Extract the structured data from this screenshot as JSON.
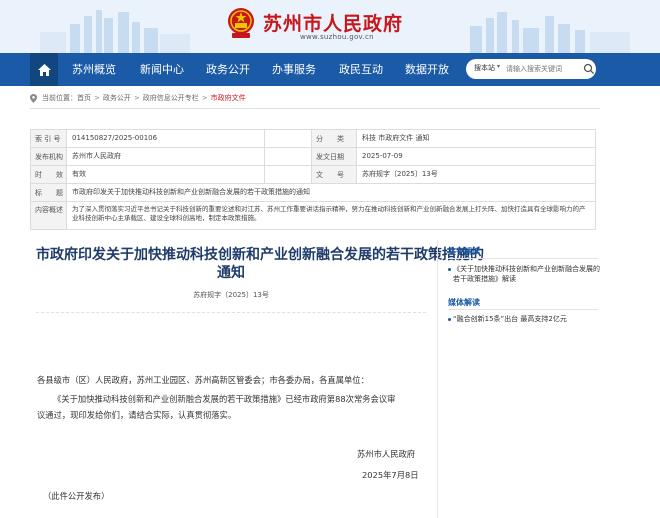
{
  "header": {
    "site_title": "苏州市人民政府",
    "site_url": "www.suzhou.gov.cn"
  },
  "nav": {
    "home_icon": "home-icon",
    "items": [
      "苏州概览",
      "新闻中心",
      "政务公开",
      "办事服务",
      "政民互动",
      "数据开放"
    ]
  },
  "search": {
    "scope_label": "搜本站",
    "placeholder": "请输入搜索关键词"
  },
  "breadcrumb": {
    "prefix": "当前位置：",
    "items": [
      "首页",
      "政务公开",
      "政府信息公开专栏",
      "市政府文件"
    ],
    "separator": ">"
  },
  "meta": {
    "index_label": "索 引 号",
    "index_value": "014150827/2025-00106",
    "category_label": "分　　类",
    "category_value": "科技 市政府文件 通知",
    "issuer_label": "发布机构",
    "issuer_value": "苏州市人民政府",
    "date_label": "发文日期",
    "date_value": "2025-07-09",
    "validity_label": "时　　效",
    "validity_value": "有效",
    "docno_label": "文　　号",
    "docno_value": "苏府规字〔2025〕13号",
    "title_label": "标　　题",
    "title_value": "市政府印发关于加快推动科技创新和产业创新融合发展的若干政策措施的通知",
    "summary_label": "内容概述",
    "summary_value_line1": "为了深入贯彻落实习近平总书记关于科技创新的重要论述和对江苏、苏州工作重要讲话指示精神，努力在推动科技创新和产业创新融合发展上打头阵、加快打造具有全球影响力的产",
    "summary_value_line2": "业科技创新中心主承载区、建设全球科创高地，制定本政策措施。"
  },
  "article": {
    "title_line1": "市政府印发关于加快推动科技创新和产业创新融合发展的若干政策措施的",
    "title_line2": "通知",
    "doc_number": "苏府规字〔2025〕13号",
    "salutation": "各县级市（区）人民政府，苏州工业园区、苏州高新区管委会；市各委办局，各直属单位：",
    "para_line1": "《关于加快推动科技创新和产业创新融合发展的若干政策措施》已经市政府第88次常务会议审",
    "para_line2": "议通过，现印发给你们，请结合实际，认真贯彻落实。",
    "signature": "苏州市人民政府",
    "sign_date": "2025年7月8日",
    "footnote": "（此件公开发布）"
  },
  "sidebar": {
    "text_interp_heading": "文字解读",
    "text_interp_link_line1": "《关于加快推动科技创新和产业创新融合发展的",
    "text_interp_link_line2": "若干政策措施》解读",
    "media_heading": "媒体解读",
    "media_link": "“融合创新15条”出台 最高支持2亿元"
  },
  "colors": {
    "nav_blue": "#1a5aa6",
    "title_red": "#c8161d",
    "article_title": "#1f3c69"
  }
}
